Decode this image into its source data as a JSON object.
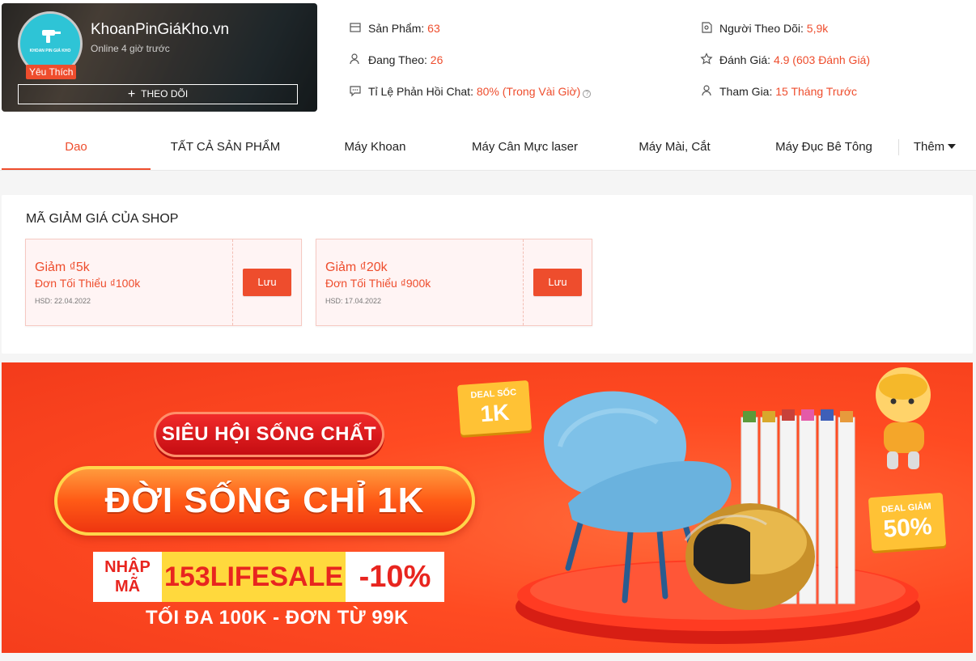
{
  "shop": {
    "name": "KhoanPinGiáKho.vn",
    "status": "Online 4 giờ trước",
    "badge": "Yêu Thích",
    "follow_label": "THEO DÕI",
    "follow_icon": "plus-icon",
    "avatar_text": "KHOAN PIN GIÁ KHO"
  },
  "stats": {
    "products_label": "Sản Phẩm:",
    "products_value": "63",
    "following_label": "Đang Theo:",
    "following_value": "26",
    "chat_label": "Tỉ Lệ Phản Hồi Chat:",
    "chat_value": "80% (Trong Vài Giờ)",
    "followers_label": "Người Theo Dõi:",
    "followers_value": "5,9k",
    "rating_label": "Đánh Giá:",
    "rating_value": "4.9 (603 Đánh Giá)",
    "joined_label": "Tham Gia:",
    "joined_value": "15 Tháng Trước"
  },
  "tabs": [
    {
      "label": "Dao",
      "active": true
    },
    {
      "label": "TẤT CẢ SẢN PHẨM"
    },
    {
      "label": "Máy Khoan"
    },
    {
      "label": "Máy Cân Mực laser"
    },
    {
      "label": "Máy Mài, Cắt"
    },
    {
      "label": "Máy Đục Bê Tông"
    },
    {
      "label": "Thêm"
    }
  ],
  "vouchers": {
    "title": "MÃ GIẢM GIÁ CỦA SHOP",
    "items": [
      {
        "amount": "Giảm ₫5k",
        "min": "Đơn Tối Thiểu ₫100k",
        "expiry": "HSD: 22.04.2022",
        "button": "Lưu"
      },
      {
        "amount": "Giảm ₫20k",
        "min": "Đơn Tối Thiểu ₫900k",
        "expiry": "HSD: 17.04.2022",
        "button": "Lưu"
      }
    ]
  },
  "banner": {
    "headline1": "SIÊU HỘI SỐNG CHẤT",
    "headline2": "ĐỜI SỐNG CHỈ 1K",
    "enter_code": "NHẬP MÃ",
    "code": "153LIFESALE",
    "discount": "-10%",
    "terms": "TỐI ĐA 100K - ĐƠN TỪ 99K",
    "deal1_top": "DEAL SỐC",
    "deal1_value": "1K",
    "deal2_top": "DEAL GIẢM",
    "deal2_value": "50%"
  },
  "colors": {
    "accent": "#ee4d2d",
    "banner_bg": "#f44a22",
    "code_bg": "#ffd93d"
  }
}
